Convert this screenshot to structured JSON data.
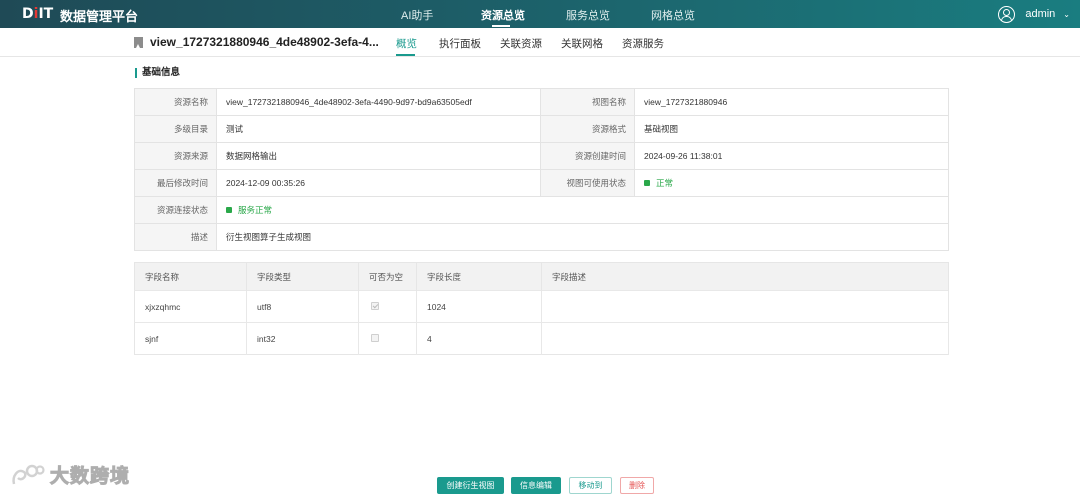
{
  "app": {
    "logo": {
      "prefix": "D",
      "dot": "i",
      "suffix": "IT"
    },
    "title": "数据管理平台"
  },
  "nav": {
    "items": [
      "AI助手",
      "资源总览",
      "服务总览",
      "网格总览"
    ],
    "active": "资源总览"
  },
  "user": {
    "name": "admin"
  },
  "view": {
    "title": "view_1727321880946_4de48902-3efa-4...",
    "tabs": [
      "概览",
      "执行面板",
      "关联资源",
      "关联网格",
      "资源服务"
    ],
    "active_tab": "概览"
  },
  "basic_info": {
    "section_title": "基础信息",
    "rows": [
      {
        "l1": "资源名称",
        "v1": "view_1727321880946_4de48902-3efa-4490-9d97-bd9a63505edf",
        "l2": "视图名称",
        "v2": "view_1727321880946"
      },
      {
        "l1": "多级目录",
        "v1": "测试",
        "l2": "资源格式",
        "v2": "基础视图"
      },
      {
        "l1": "资源来源",
        "v1": "数据网格输出",
        "l2": "资源创建时间",
        "v2": "2024-09-26 11:38:01"
      },
      {
        "l1": "最后修改时间",
        "v1": "2024-12-09 00:35:26",
        "l2": "视图可使用状态",
        "v2": "正常"
      }
    ],
    "connection_label": "资源连接状态",
    "connection_status": "服务正常",
    "desc_label": "描述",
    "desc_value": "衍生视图算子生成视图",
    "status_color": "#2aa84a"
  },
  "fields_table": {
    "headers": [
      "字段名称",
      "字段类型",
      "可否为空",
      "字段长度",
      "字段描述"
    ],
    "rows": [
      {
        "name": "xjxzqhmc",
        "type": "utf8",
        "nullable": true,
        "length": "1024",
        "desc": ""
      },
      {
        "name": "sjnf",
        "type": "int32",
        "nullable": false,
        "length": "4",
        "desc": ""
      }
    ]
  },
  "actions": {
    "create_derived": "创建衍生视图",
    "edit_info": "信息编辑",
    "move_to": "移动到",
    "delete": "删除"
  },
  "watermark": {
    "text": "大数跨境"
  },
  "colors": {
    "accent": "#1a9a8e",
    "nav_bg": "#1f4a56",
    "danger": "#e55353"
  }
}
